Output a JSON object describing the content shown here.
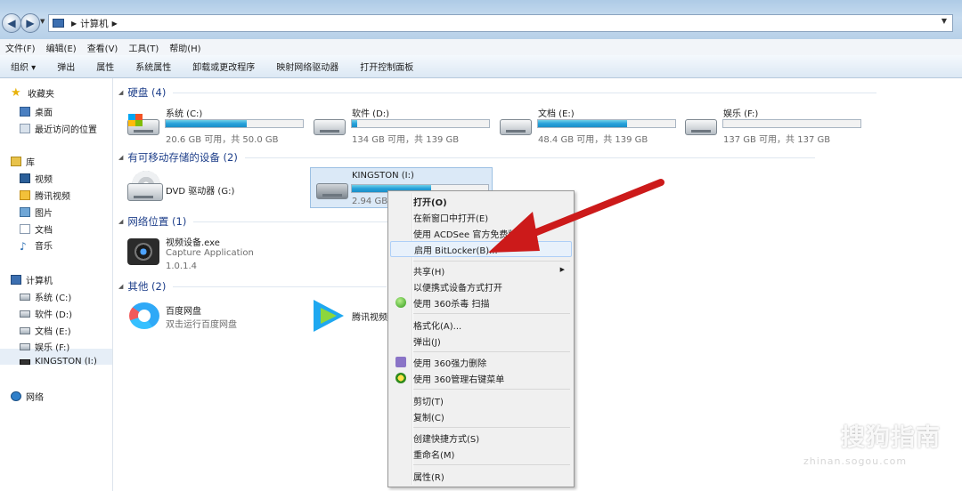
{
  "window": {
    "address": {
      "path": [
        "计算机"
      ]
    }
  },
  "menubar": [
    "文件(F)",
    "编辑(E)",
    "查看(V)",
    "工具(T)",
    "帮助(H)"
  ],
  "commandbar": [
    "组织 ▾",
    "弹出",
    "属性",
    "系统属性",
    "卸载或更改程序",
    "映射网络驱动器",
    "打开控制面板"
  ],
  "nav": {
    "favorites": "收藏夹",
    "fav_items": [
      "桌面",
      "最近访问的位置"
    ],
    "libraries": "库",
    "lib_items": [
      "视频",
      "腾讯视频",
      "图片",
      "文档",
      "音乐"
    ],
    "computer": "计算机",
    "computer_items": [
      "系统 (C:)",
      "软件 (D:)",
      "文档 (E:)",
      "娱乐 (F:)",
      "KINGSTON (I:)"
    ],
    "network": "网络"
  },
  "groups": {
    "hdd": "硬盘 (4)",
    "removable": "有可移动存储的设备 (2)",
    "network": "网络位置 (1)",
    "other": "其他 (2)"
  },
  "drives": [
    {
      "name": "系统 (C:)",
      "free": "20.6 GB 可用，共 50.0 GB",
      "used_fraction": 0.59
    },
    {
      "name": "软件 (D:)",
      "free": "134 GB 可用，共 139 GB",
      "used_fraction": 0.04
    },
    {
      "name": "文档 (E:)",
      "free": "48.4 GB 可用，共 139 GB",
      "used_fraction": 0.65
    },
    {
      "name": "娱乐 (F:)",
      "free": "137 GB 可用，共 137 GB",
      "used_fraction": 0.0
    }
  ],
  "removable": {
    "dvd": "DVD 驱动器 (G:)",
    "kingston": {
      "name": "KINGSTON (I:)",
      "free": "2.94 GB",
      "used_fraction": 0.58
    }
  },
  "network_item": {
    "name": "视频设备.exe",
    "desc": "Capture Application",
    "version": "1.0.1.4"
  },
  "other_items": [
    {
      "name": "百度网盘",
      "desc": "双击运行百度网盘"
    },
    {
      "name": "腾讯视频"
    }
  ],
  "context_menu": [
    "打开(O)",
    "在新窗口中打开(E)",
    "使用 ACDSee 官方免费版 管理",
    "启用 BitLocker(B)...",
    "共享(H)",
    "以便携式设备方式打开",
    "使用 360杀毒 扫描",
    "格式化(A)...",
    "弹出(J)",
    "使用 360强力删除",
    "使用 360管理右键菜单",
    "剪切(T)",
    "复制(C)",
    "创建快捷方式(S)",
    "重命名(M)",
    "属性(R)"
  ],
  "colors": {
    "accent_arrow": "#cc1a1a",
    "bar_fill": "#26a0da",
    "group_header": "#1e3f8a"
  },
  "watermark": {
    "text": "搜狗指南",
    "url": "zhinan.sogou.com"
  }
}
